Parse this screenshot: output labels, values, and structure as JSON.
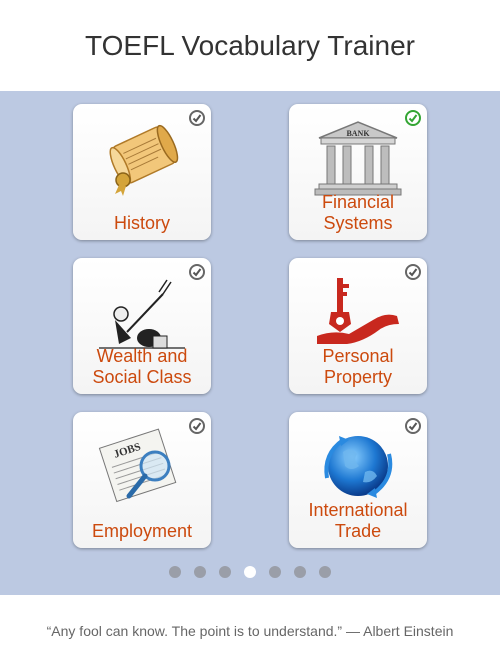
{
  "header": {
    "title": "TOEFL Vocabulary Trainer"
  },
  "tiles": [
    {
      "label": "History",
      "icon": "scroll-icon",
      "completed": false
    },
    {
      "label": "Financial\nSystems",
      "icon": "bank-icon",
      "art_text": "BANK",
      "completed": true
    },
    {
      "label": "Wealth and\nSocial Class",
      "icon": "wealth-cartoon-icon",
      "completed": false
    },
    {
      "label": "Personal\nProperty",
      "icon": "hand-key-icon",
      "completed": false
    },
    {
      "label": "Employment",
      "icon": "jobs-newspaper-icon",
      "art_text": "JOBS",
      "completed": false
    },
    {
      "label": "International\nTrade",
      "icon": "globe-icon",
      "completed": false
    }
  ],
  "pagination": {
    "count": 7,
    "active_index": 3
  },
  "footer": {
    "quote": "“Any fool can know. The point is to understand.” — Albert Einstein"
  },
  "colors": {
    "background": "#bcc9e2",
    "label": "#cc4a0e",
    "check_done": "#33a533"
  }
}
